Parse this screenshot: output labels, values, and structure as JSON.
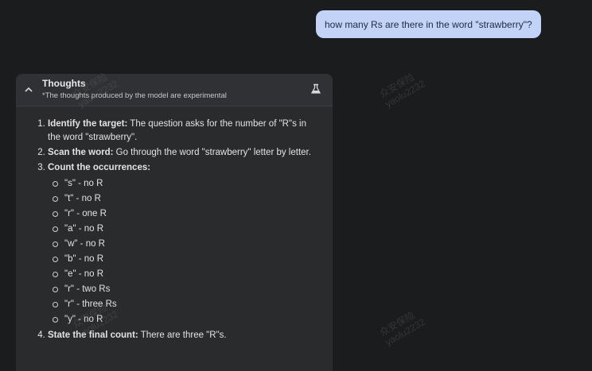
{
  "user_message": "how many Rs are there in the word \"strawberry\"?",
  "thoughts": {
    "title": "Thoughts",
    "subtitle": "*The thoughts produced by the model are experimental",
    "steps": [
      {
        "label": "Identify the target:",
        "text": " The question asks for the number of \"R\"s in the word \"strawberry\"."
      },
      {
        "label": "Scan the word:",
        "text": " Go through the word \"strawberry\" letter by letter."
      },
      {
        "label": "Count the occurrences:",
        "text": ""
      },
      {
        "label": "State the final count:",
        "text": " There are three \"R\"s."
      }
    ],
    "letters": [
      "\"s\" - no R",
      "\"t\" - no R",
      "\"r\" - one R",
      "\"a\" - no R",
      "\"w\" - no R",
      "\"b\" - no R",
      "\"e\" - no R",
      "\"r\" - two Rs",
      "\"r\" - three Rs",
      "\"y\" - no R"
    ]
  },
  "watermark": {
    "line1": "众安保险",
    "line2": "yaolu2232"
  },
  "icons": {
    "collapse": "chevron-up-icon",
    "experimental": "flask-icon"
  },
  "colors": {
    "background": "#1b1c1d",
    "panel": "#2a2b2d",
    "user_bubble": "#c2d3f7"
  }
}
